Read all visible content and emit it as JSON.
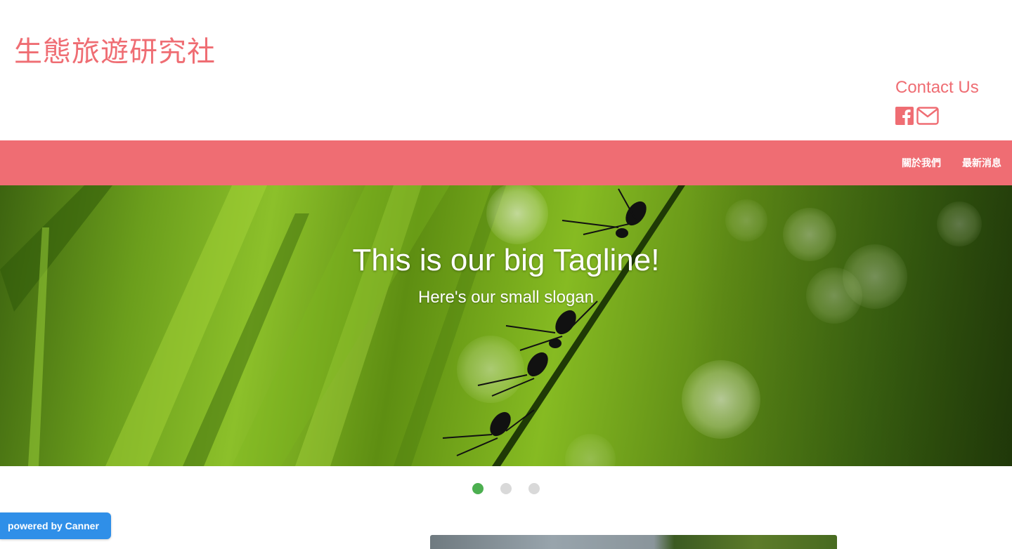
{
  "site": {
    "title": "生態旅遊研究社",
    "contact_title": "Contact Us",
    "contact_icons": [
      "facebook-icon",
      "envelope-icon"
    ]
  },
  "nav": {
    "items": [
      {
        "label": "關於我們"
      },
      {
        "label": "最新消息"
      }
    ]
  },
  "hero": {
    "tagline": "This is our big Tagline!",
    "slogan": "Here's our small slogan"
  },
  "carousel": {
    "slide_count": 3,
    "active_index": 0
  },
  "badge": {
    "label": "powered by Canner"
  },
  "colors": {
    "accent": "#ef6d73",
    "nav_text": "#ffffff",
    "active_dot": "#4caf50",
    "inactive_dot": "#d9d9d9",
    "badge_bg": "#2f8fe8"
  }
}
